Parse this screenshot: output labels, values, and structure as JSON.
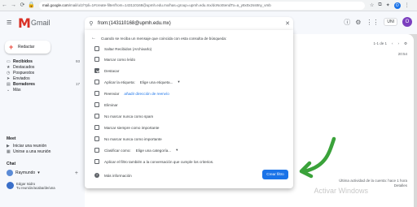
{
  "browser": {
    "url_domain": "mail.google.com",
    "url_path": "/mail/u/2/?pli=1#create-filter/from=143110168@upmh.edu.mx/has=group=upmh.edu.mx/doNotSendTo=a_y8x0x2ss8ny_vmb"
  },
  "header": {
    "app_name": "Gmail",
    "org_badge": "UNI",
    "avatar_initial": "O"
  },
  "search": {
    "query": "from:(143110168@upmh.edu.mx)"
  },
  "sidebar": {
    "compose_label": "Redactar",
    "items": [
      {
        "label": "Recibidos",
        "count": "93",
        "icon": "inbox-icon",
        "bold": true
      },
      {
        "label": "Destacados",
        "count": "",
        "icon": "star-icon",
        "bold": false
      },
      {
        "label": "Pospuestos",
        "count": "",
        "icon": "clock-icon",
        "bold": false
      },
      {
        "label": "Enviados",
        "count": "",
        "icon": "send-icon",
        "bold": false
      },
      {
        "label": "Borradores",
        "count": "17",
        "icon": "draft-icon",
        "bold": true
      },
      {
        "label": "Más",
        "count": "",
        "icon": "chevron-down-icon",
        "bold": false
      }
    ],
    "meet_title": "Meet",
    "meet_items": [
      "Iniciar una reunión",
      "Unirse a una reunión"
    ],
    "chat_title": "Chat",
    "chat_user": "Raymundo",
    "contact_name": "Edgar Isidro",
    "contact_status": "Tu reunión/acaba/de/una"
  },
  "main": {
    "toolbar_count": "1-1 de 1",
    "time": "20:54",
    "activity": "Última actividad de la cuenta: hace 1 hora",
    "activity_details": "Detalles",
    "watermark": "Activar Windows"
  },
  "filter_panel": {
    "header": "Cuando se reciba un mensaje que coincida con esta consulta de búsqueda:",
    "options": [
      {
        "label": "Saltar Recibidos (Archivarlo)",
        "checked": false
      },
      {
        "label": "Marcar como leído",
        "checked": false
      },
      {
        "label": "Destacar",
        "checked": true
      },
      {
        "label": "Aplicar la etiqueta:",
        "extra": "Elige una etiqueta...",
        "checked": false
      },
      {
        "label": "Reenviar",
        "extra": "añadir dirección de reenvío",
        "checked": false
      },
      {
        "label": "Eliminar",
        "checked": false
      },
      {
        "label": "No marcar nunca como spam",
        "checked": false
      },
      {
        "label": "Marcar siempre como importante",
        "checked": false
      },
      {
        "label": "No marcar nunca como importante",
        "checked": false
      },
      {
        "label": "Clasificar como:",
        "extra": "Elige una categoría...",
        "checked": false
      },
      {
        "label": "Aplicar el filtro también a la conversación que cumple los criterios.",
        "checked": false
      }
    ],
    "more_info": "Más información",
    "create_button": "Crear filtro"
  },
  "colors": {
    "primary": "#1a73e8",
    "annotation_arrow": "#3aa23a",
    "gmail_red": "#d93025"
  }
}
